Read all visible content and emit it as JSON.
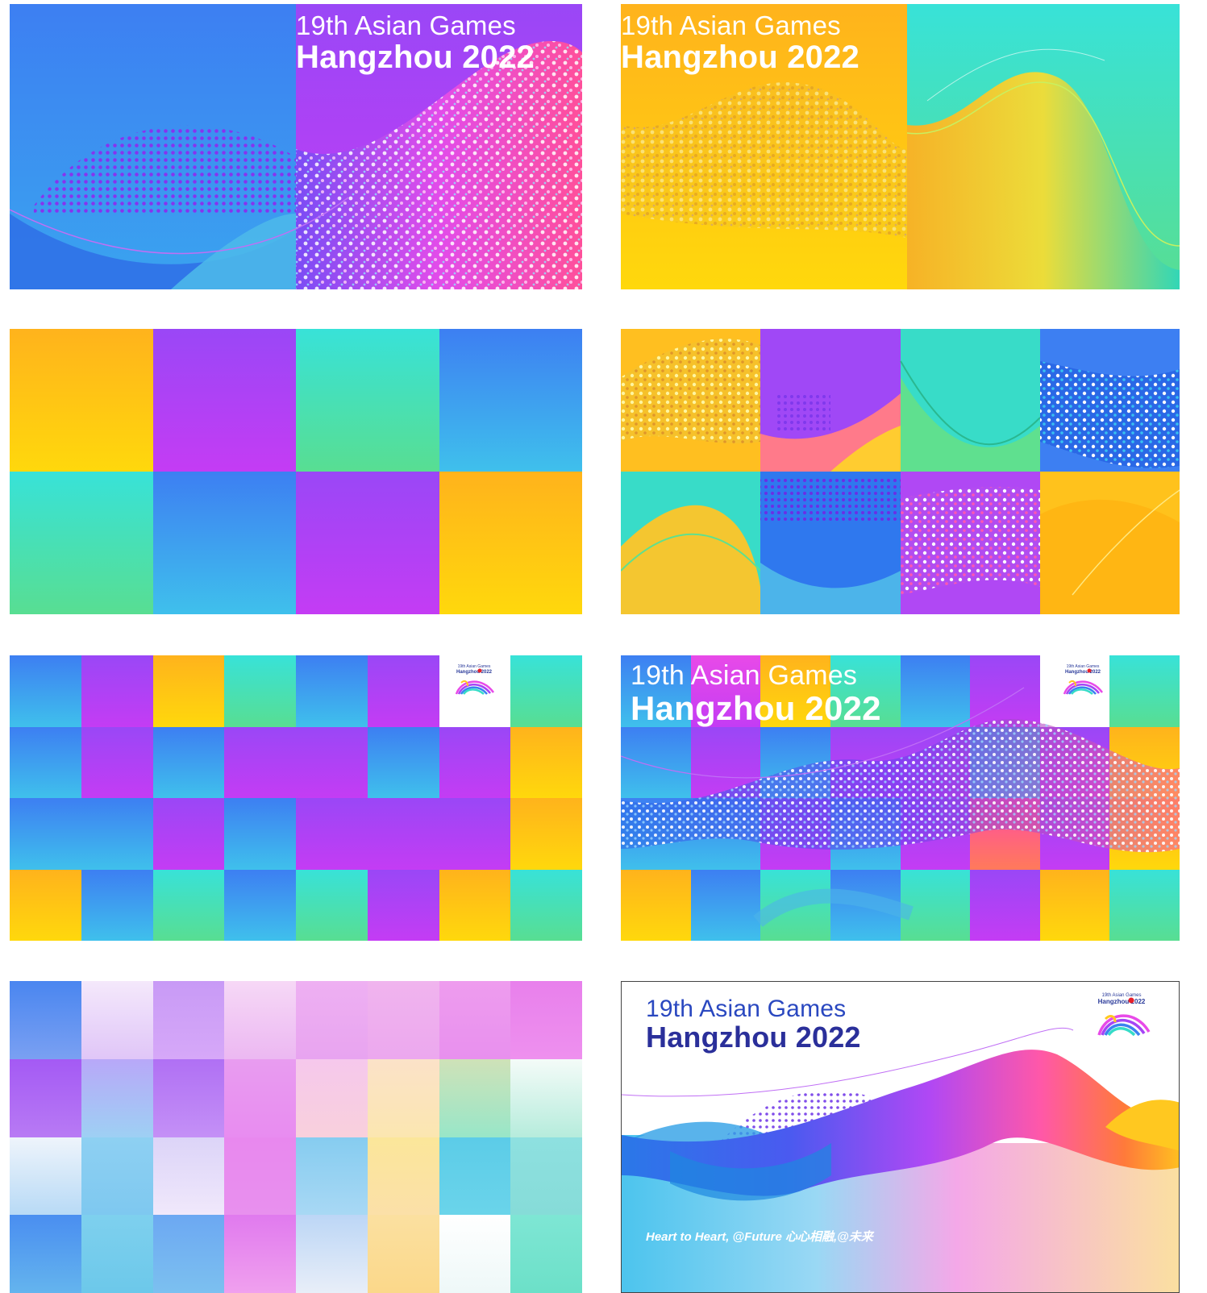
{
  "title_line1": "19th Asian Games",
  "title_line2": "Hangzhou 2022",
  "logo": {
    "caption_line1": "19th Asian Games",
    "caption_line2": "Hangzhou 2022"
  },
  "slogan": "Heart to Heart, @Future  心心相融,@未来",
  "palette": {
    "blue": "#3b82f0",
    "purple": "#a645f5",
    "yellow": "#ffc820",
    "teal": "#36dcc8",
    "green": "#5fe08f",
    "magenta": "#e84ae8",
    "sky": "#4bc0ee",
    "navy": "#2a3a9a"
  }
}
